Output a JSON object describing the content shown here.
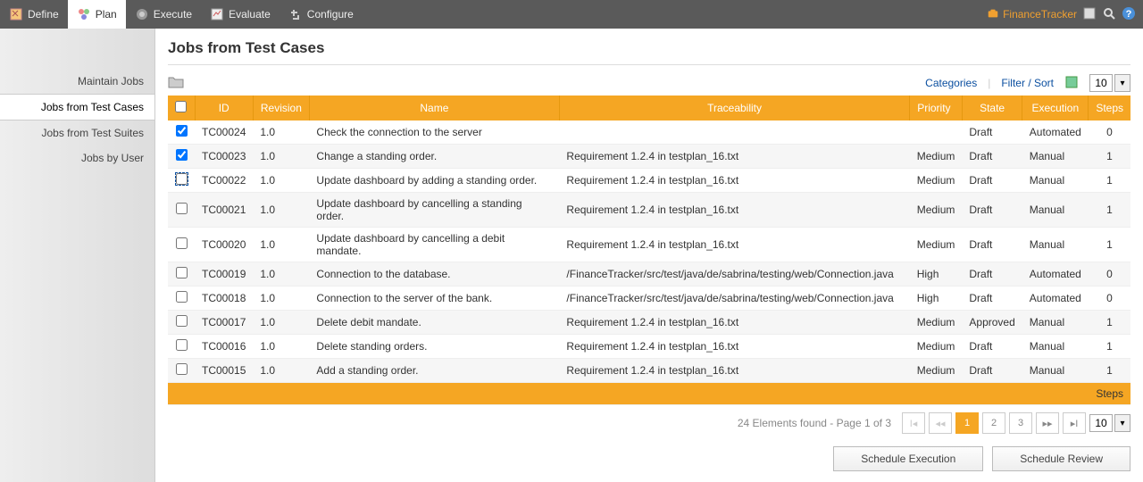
{
  "topnav": {
    "items": [
      {
        "label": "Define",
        "active": false
      },
      {
        "label": "Plan",
        "active": true
      },
      {
        "label": "Execute",
        "active": false
      },
      {
        "label": "Evaluate",
        "active": false
      },
      {
        "label": "Configure",
        "active": false
      }
    ],
    "project": "FinanceTracker"
  },
  "sidebar": {
    "items": [
      {
        "label": "Maintain Jobs",
        "active": false
      },
      {
        "label": "Jobs from Test Cases",
        "active": true
      },
      {
        "label": "Jobs from Test Suites",
        "active": false
      },
      {
        "label": "Jobs by User",
        "active": false
      }
    ]
  },
  "page_title": "Jobs from Test Cases",
  "toolbar": {
    "categories": "Categories",
    "filter_sort": "Filter / Sort",
    "page_size": "10"
  },
  "columns": {
    "id": "ID",
    "revision": "Revision",
    "name": "Name",
    "traceability": "Traceability",
    "priority": "Priority",
    "state": "State",
    "execution": "Execution",
    "steps": "Steps"
  },
  "rows": [
    {
      "checked": true,
      "id": "TC00024",
      "rev": "1.0",
      "name": "Check the connection to the server",
      "trace": "",
      "prio": "",
      "state": "Draft",
      "exec": "Automated",
      "steps": "0"
    },
    {
      "checked": true,
      "id": "TC00023",
      "rev": "1.0",
      "name": "Change a standing order.",
      "trace": "Requirement 1.2.4 in testplan_16.txt",
      "prio": "Medium",
      "state": "Draft",
      "exec": "Manual",
      "steps": "1"
    },
    {
      "checked": "partial",
      "id": "TC00022",
      "rev": "1.0",
      "name": "Update dashboard by adding a standing order.",
      "trace": "Requirement 1.2.4 in testplan_16.txt",
      "prio": "Medium",
      "state": "Draft",
      "exec": "Manual",
      "steps": "1"
    },
    {
      "checked": false,
      "id": "TC00021",
      "rev": "1.0",
      "name": "Update dashboard by cancelling a standing order.",
      "trace": "Requirement 1.2.4 in testplan_16.txt",
      "prio": "Medium",
      "state": "Draft",
      "exec": "Manual",
      "steps": "1"
    },
    {
      "checked": false,
      "id": "TC00020",
      "rev": "1.0",
      "name": "Update dashboard by cancelling a debit mandate.",
      "trace": "Requirement 1.2.4 in testplan_16.txt",
      "prio": "Medium",
      "state": "Draft",
      "exec": "Manual",
      "steps": "1"
    },
    {
      "checked": false,
      "id": "TC00019",
      "rev": "1.0",
      "name": "Connection to the database.",
      "trace": "/FinanceTracker/src/test/java/de/sabrina/testing/web/Connection.java",
      "prio": "High",
      "state": "Draft",
      "exec": "Automated",
      "steps": "0"
    },
    {
      "checked": false,
      "id": "TC00018",
      "rev": "1.0",
      "name": "Connection to the server of the bank.",
      "trace": "/FinanceTracker/src/test/java/de/sabrina/testing/web/Connection.java",
      "prio": "High",
      "state": "Draft",
      "exec": "Automated",
      "steps": "0"
    },
    {
      "checked": false,
      "id": "TC00017",
      "rev": "1.0",
      "name": "Delete debit mandate.",
      "trace": "Requirement 1.2.4 in testplan_16.txt",
      "prio": "Medium",
      "state": "Approved",
      "exec": "Manual",
      "steps": "1"
    },
    {
      "checked": false,
      "id": "TC00016",
      "rev": "1.0",
      "name": "Delete standing orders.",
      "trace": "Requirement 1.2.4 in testplan_16.txt",
      "prio": "Medium",
      "state": "Draft",
      "exec": "Manual",
      "steps": "1"
    },
    {
      "checked": false,
      "id": "TC00015",
      "rev": "1.0",
      "name": "Add a standing order.",
      "trace": "Requirement 1.2.4 in testplan_16.txt",
      "prio": "Medium",
      "state": "Draft",
      "exec": "Manual",
      "steps": "1"
    }
  ],
  "footer_label": "Steps",
  "pager": {
    "info": "24 Elements found - Page 1 of 3",
    "pages": [
      "1",
      "2",
      "3"
    ],
    "active_page": "1",
    "page_size": "10"
  },
  "actions": {
    "schedule_execution": "Schedule Execution",
    "schedule_review": "Schedule Review"
  }
}
